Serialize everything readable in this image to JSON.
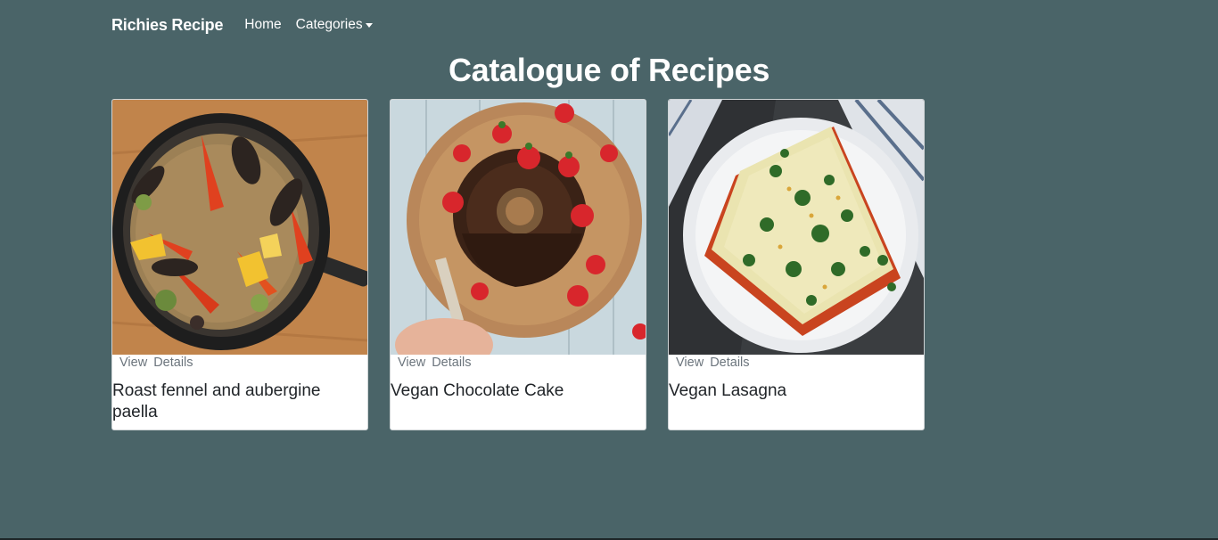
{
  "navbar": {
    "brand": "Richies Recipe",
    "links": [
      {
        "label": "Home"
      },
      {
        "label": "Categories",
        "dropdown": true
      }
    ]
  },
  "page_title": "Catalogue of Recipes",
  "recipes": [
    {
      "title": "Roast fennel and aubergine paella",
      "link": "View  Details",
      "image": "paella-photo"
    },
    {
      "title": "Vegan Chocolate Cake",
      "link": "View  Details",
      "image": "chocolate-bundt-cake-photo"
    },
    {
      "title": "Vegan Lasagna",
      "link": "View  Details",
      "image": "lasagna-photo"
    }
  ],
  "colors": {
    "background": "#4a6468",
    "card": "#ffffff",
    "link_muted": "#6c757d",
    "title_text": "#212529"
  }
}
